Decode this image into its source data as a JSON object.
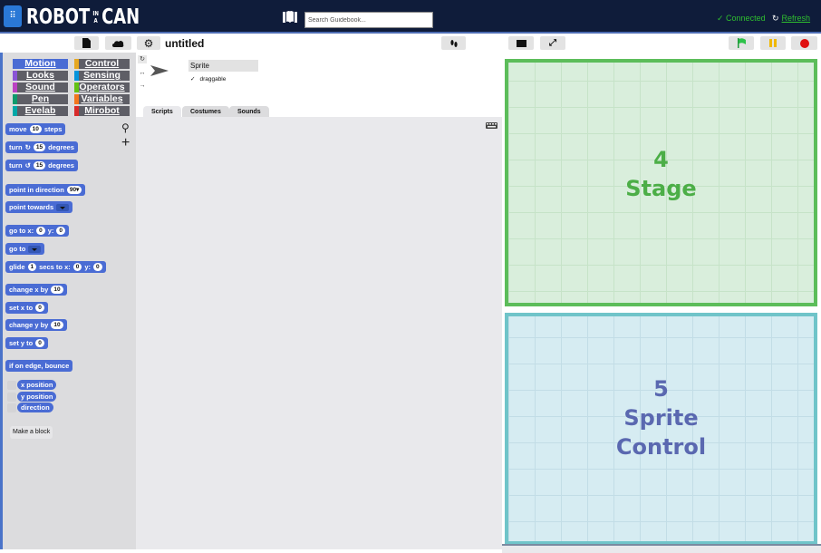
{
  "app": {
    "menu_icon": "grid-menu-icon",
    "logo_left": "ROBOT",
    "logo_in_top": "IN",
    "logo_in_bottom": "A",
    "logo_right": "CAN"
  },
  "topbar": {
    "search_placeholder": "Search Guidebook...",
    "connected": "✓ Connected",
    "refresh_icon": "↻",
    "refresh": "Refresh",
    "colors": {
      "background": "#0f1c3a",
      "status": "#2fbf2f"
    }
  },
  "toolbar": {
    "project_title": "untitled",
    "icons": [
      "file-icon",
      "cloud-icon",
      "gear-icon",
      "footprints-icon",
      "stage-size-icon",
      "fullscreen-icon",
      "green-flag-icon",
      "pause-icon",
      "stop-icon"
    ]
  },
  "categories": [
    {
      "label": "Motion",
      "color": "#4a6cd4"
    },
    {
      "label": "Control",
      "color": "#e6a822"
    },
    {
      "label": "Looks",
      "color": "#8a55d7"
    },
    {
      "label": "Sensing",
      "color": "#0494dc"
    },
    {
      "label": "Sound",
      "color": "#bb42c3"
    },
    {
      "label": "Operators",
      "color": "#62c213"
    },
    {
      "label": "Pen",
      "color": "#0e9a6c"
    },
    {
      "label": "Variables",
      "color": "#f3761d"
    },
    {
      "label": "Evelab",
      "color": "#00a8a8"
    },
    {
      "label": "Mirobot",
      "color": "#d82b2b"
    }
  ],
  "blocks": {
    "move": {
      "pre": "move",
      "val": "10",
      "post": "steps"
    },
    "turn_cw": {
      "pre": "turn",
      "icon": "↻",
      "val": "15",
      "post": "degrees"
    },
    "turn_ccw": {
      "pre": "turn",
      "icon": "↺",
      "val": "15",
      "post": "degrees"
    },
    "point_dir": {
      "pre": "point in direction",
      "val": "90▾"
    },
    "point_towards": {
      "pre": "point towards"
    },
    "go_to_xy": {
      "pre": "go to x:",
      "x": "0",
      "mid": "y:",
      "y": "0"
    },
    "go_to": {
      "pre": "go to"
    },
    "glide": {
      "pre": "glide",
      "secs": "1",
      "mid": "secs to x:",
      "x": "0",
      "mid2": "y:",
      "y": "0"
    },
    "change_x": {
      "pre": "change x by",
      "val": "10"
    },
    "set_x": {
      "pre": "set x to",
      "val": "0"
    },
    "change_y": {
      "pre": "change y by",
      "val": "10"
    },
    "set_y": {
      "pre": "set y to",
      "val": "0"
    },
    "bounce": {
      "pre": "if on edge, bounce"
    },
    "x_position": "x position",
    "y_position": "y position",
    "direction": "direction",
    "make_block": "Make a block"
  },
  "sprite": {
    "name": "Sprite",
    "draggable_check": "✓",
    "draggable": "draggable",
    "rotation_icons": [
      "↻",
      "↔",
      "→"
    ]
  },
  "tabs": [
    "Scripts",
    "Costumes",
    "Sounds"
  ],
  "stage": {
    "number": "4",
    "label": "Stage",
    "color": "#4cae47"
  },
  "sprite_control": {
    "number": "5",
    "line1": "Sprite",
    "line2": "Control",
    "color": "#5a68b0"
  }
}
